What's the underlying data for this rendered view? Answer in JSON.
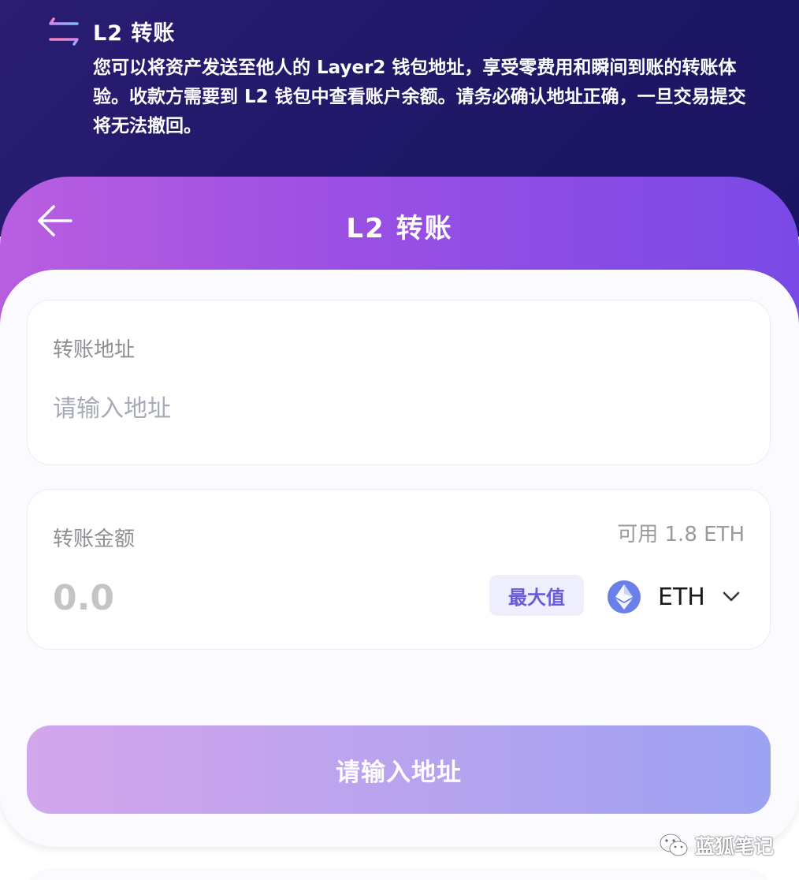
{
  "banner": {
    "title": "L2 转账",
    "description": "您可以将资产发送至他人的 Layer2 钱包地址，享受零费用和瞬间到账的转账体验。收款方需要到 L2 钱包中查看账户余额。请务必确认地址正确，一旦交易提交将无法撤回。",
    "icon": "transfer-arrows-icon"
  },
  "header": {
    "title": "L2 转账",
    "back_icon": "back-arrow-icon",
    "gradient_start": "#b95ee0",
    "gradient_end": "#7a4ae6"
  },
  "address_field": {
    "label": "转账地址",
    "value": "",
    "placeholder": "请输入地址"
  },
  "amount_field": {
    "label": "转账金额",
    "available": "可用 1.8 ETH",
    "value": "",
    "placeholder": "0.0",
    "max_label": "最大值",
    "token": "ETH",
    "token_icon": "ethereum-icon",
    "dropdown_icon": "chevron-down-icon"
  },
  "submit": {
    "label": "请输入地址"
  },
  "watermark": {
    "text": "蓝狐笔记",
    "icon": "wechat-icon"
  },
  "colors": {
    "banner_bg": "#1e1766",
    "accent": "#6a5ad8",
    "button_gradient": [
      "#d4a6ec",
      "#9da2f2"
    ]
  }
}
